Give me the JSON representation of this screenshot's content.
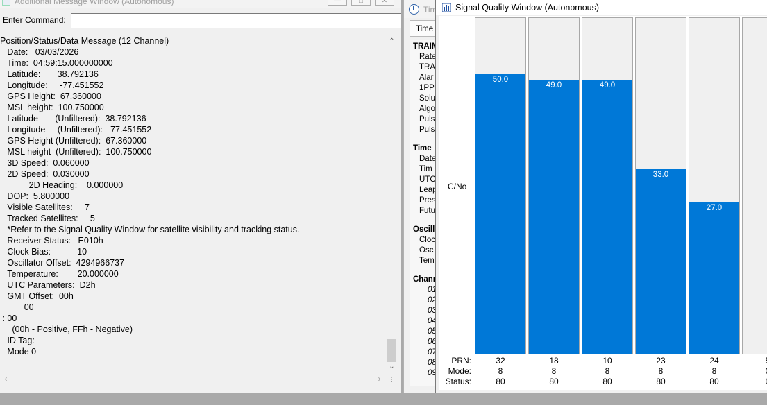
{
  "message_window": {
    "title": "Additional Message Window (Autonomous)",
    "command_label": "Enter Command:",
    "command_value": "",
    "lines": [
      "Position/Status/Data Message (12 Channel)",
      "   Date:   03/03/2026",
      "   Time:  04:59:15.000000000",
      "   Latitude:       38.792136",
      "   Longitude:     -77.451552",
      "   GPS Height:  67.360000",
      "   MSL height:  100.750000",
      "   Latitude       (Unfiltered):  38.792136",
      "   Longitude     (Unfiltered):  -77.451552",
      "   GPS Height (Unfiltered):  67.360000",
      "   MSL height  (Unfiltered):  100.750000",
      "   3D Speed:  0.060000",
      "   2D Speed:  0.030000",
      "            2D Heading:    0.000000",
      "   DOP:  5.800000",
      "   Visible Satellites:     7",
      "   Tracked Satellites:     5",
      "   *Refer to the Signal Quality Window for satellite visibility and tracking status.",
      "   Receiver Status:   E010h",
      "   Clock Bias:           10",
      "   Oscillator Offset:  4294966737",
      "   Temperature:        20.000000",
      "   UTC Parameters:  D2h",
      "   GMT Offset:  00h",
      "          00",
      " : 00",
      "     (00h - Positive, FFh - Negative)",
      "   ID Tag:",
      "   Mode 0"
    ]
  },
  "time_window": {
    "title": "Tim",
    "tab_label": "Time A",
    "items": [
      {
        "text": "TRAIM",
        "kind": "hd"
      },
      {
        "text": "Rate",
        "kind": "sub"
      },
      {
        "text": "TRA",
        "kind": "sub"
      },
      {
        "text": "Alar",
        "kind": "sub"
      },
      {
        "text": "1PP",
        "kind": "sub"
      },
      {
        "text": "Solu",
        "kind": "sub"
      },
      {
        "text": "Algo",
        "kind": "sub"
      },
      {
        "text": "Puls",
        "kind": "sub"
      },
      {
        "text": "Puls",
        "kind": "sub"
      },
      {
        "text": "",
        "kind": "gap"
      },
      {
        "text": "Time",
        "kind": "hd"
      },
      {
        "text": "Date",
        "kind": "sub"
      },
      {
        "text": "Tim",
        "kind": "sub"
      },
      {
        "text": "UTC",
        "kind": "sub"
      },
      {
        "text": "Leap",
        "kind": "sub"
      },
      {
        "text": "Pres",
        "kind": "sub"
      },
      {
        "text": "Futu",
        "kind": "sub"
      },
      {
        "text": "",
        "kind": "gap"
      },
      {
        "text": "Oscill",
        "kind": "hd"
      },
      {
        "text": "Cloc",
        "kind": "sub"
      },
      {
        "text": "Osc",
        "kind": "sub"
      },
      {
        "text": "Tem",
        "kind": "sub"
      },
      {
        "text": "",
        "kind": "gap"
      },
      {
        "text": "Chann",
        "kind": "hd"
      },
      {
        "text": "01",
        "kind": "ch"
      },
      {
        "text": "02",
        "kind": "ch"
      },
      {
        "text": "03",
        "kind": "ch"
      },
      {
        "text": "04",
        "kind": "ch"
      },
      {
        "text": "05",
        "kind": "ch"
      },
      {
        "text": "06",
        "kind": "ch"
      },
      {
        "text": "07",
        "kind": "ch"
      },
      {
        "text": "08",
        "kind": "ch"
      },
      {
        "text": "09",
        "kind": "ch"
      }
    ]
  },
  "signal_window": {
    "title": "Signal Quality Window (Autonomous)",
    "y_label": "C/No",
    "row_labels": {
      "prn": "PRN:",
      "mode": "Mode:",
      "status": "Status:"
    },
    "bar_color": "#0078d7"
  },
  "chart_data": {
    "type": "bar",
    "ylabel": "C/No",
    "ylim": [
      0,
      60
    ],
    "categories": [
      "32",
      "18",
      "10",
      "23",
      "24",
      "5"
    ],
    "values": [
      50.0,
      49.0,
      49.0,
      33.0,
      27.0,
      null
    ],
    "value_labels": [
      "50.0",
      "49.0",
      "49.0",
      "33.0",
      "27.0",
      ""
    ],
    "prn": [
      "32",
      "18",
      "10",
      "23",
      "24",
      "5"
    ],
    "mode": [
      "8",
      "8",
      "8",
      "8",
      "8",
      "0"
    ],
    "status": [
      "80",
      "80",
      "80",
      "80",
      "80",
      "0"
    ]
  }
}
